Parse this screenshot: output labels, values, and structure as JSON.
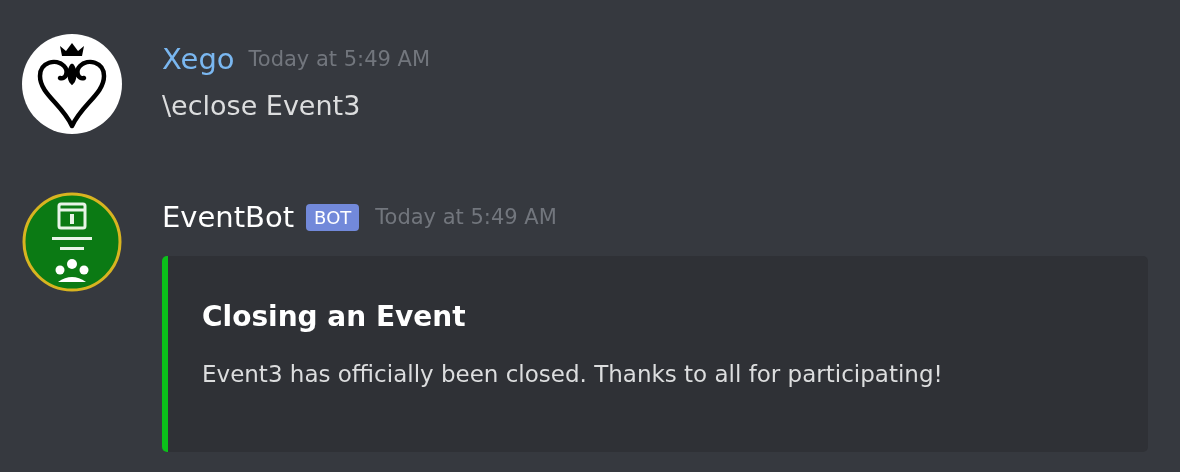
{
  "messages": [
    {
      "kind": "user",
      "author": "Xego",
      "color": "#7ab7f0",
      "timestamp": "Today at 5:49 AM",
      "content": "\\eclose Event3"
    },
    {
      "kind": "bot",
      "author": "EventBot",
      "color": "#ffffff",
      "bot_tag": "BOT",
      "timestamp": "Today at 5:49 AM",
      "embed": {
        "color": "#0bc01a",
        "title": "Closing an Event",
        "description": "Event3 has officially been closed. Thanks to all for participating!"
      }
    }
  ]
}
